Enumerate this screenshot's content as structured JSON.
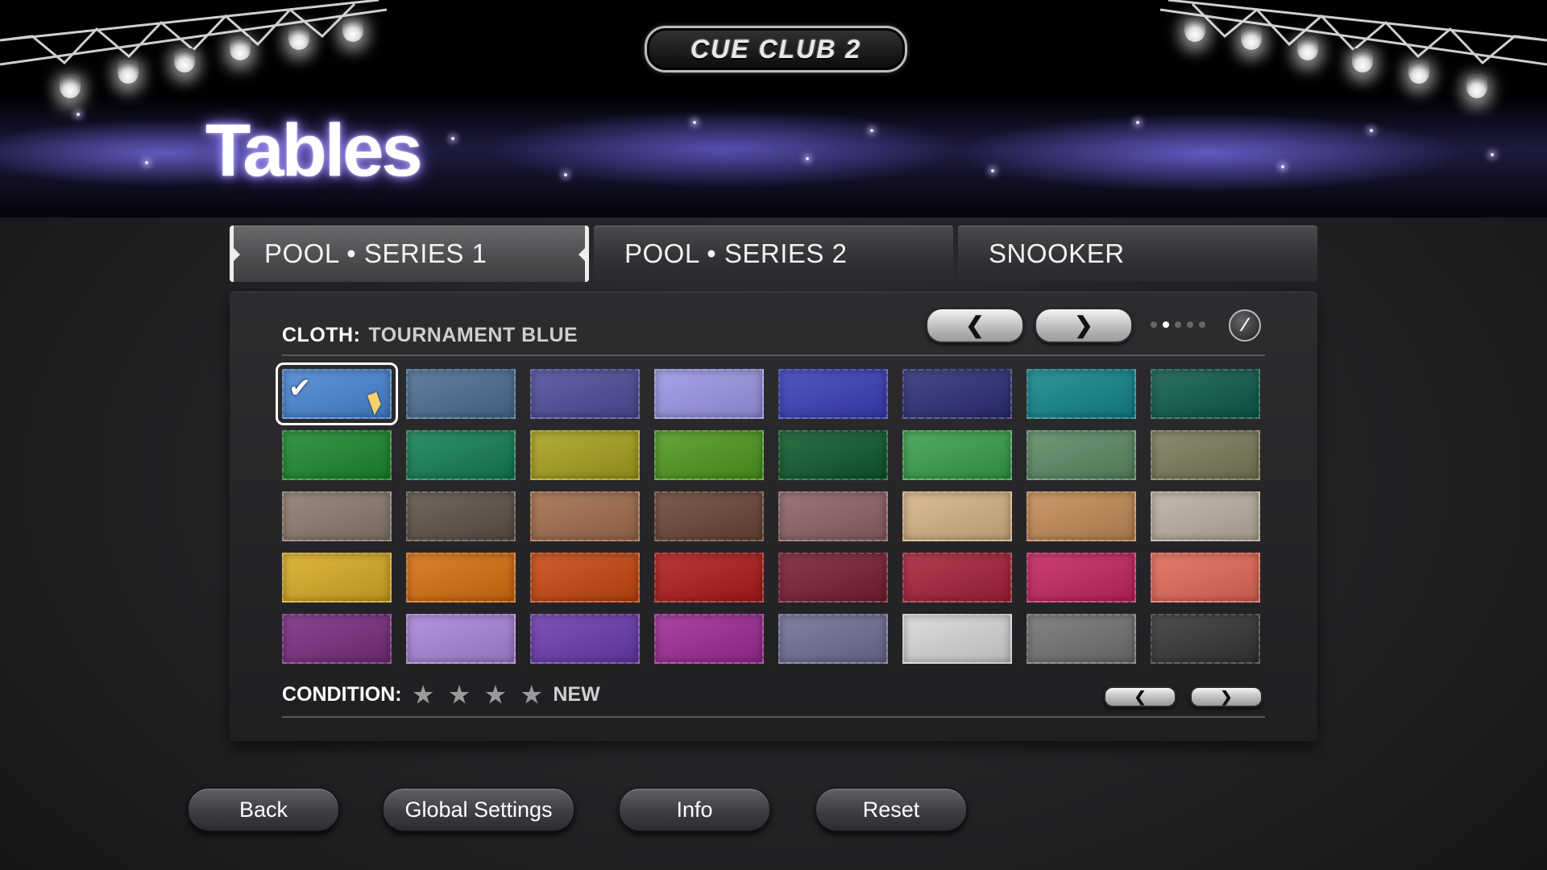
{
  "logo_text": "CUE CLUB 2",
  "page_title": "Tables",
  "tabs": [
    {
      "label": "POOL  •  SERIES 1",
      "active": true
    },
    {
      "label": "POOL  •  SERIES 2",
      "active": false
    },
    {
      "label": "SNOOKER",
      "active": false
    }
  ],
  "cloth": {
    "label": "CLOTH:",
    "value": "TOURNAMENT BLUE",
    "prev_icon": "chevron-left-icon",
    "next_icon": "chevron-right-icon",
    "page_indicator": {
      "total": 5,
      "current": 2
    },
    "swatches": [
      "#4a86d4",
      "#4c6e93",
      "#4e4d9a",
      "#9c97e6",
      "#3b3fb8",
      "#2e2f78",
      "#13868c",
      "#0f5d4d",
      "#1c8a2e",
      "#148055",
      "#a8a21d",
      "#4f9a1e",
      "#0f5b2c",
      "#38a04a",
      "#5e8a65",
      "#7c7b5c",
      "#8c7b6d",
      "#5f5248",
      "#a26e4c",
      "#6b4638",
      "#8e6366",
      "#d7b485",
      "#c48b57",
      "#bdb0a0",
      "#d8ac25",
      "#d8700f",
      "#c84810",
      "#b01c1c",
      "#7a2034",
      "#a8223a",
      "#c42660",
      "#e46a58",
      "#7a2d80",
      "#a986db",
      "#6b3cae",
      "#9e2b96",
      "#6f7096",
      "#d8d8d8",
      "#737373",
      "#363636"
    ],
    "selected_index": 0
  },
  "condition": {
    "label": "CONDITION:",
    "stars": "★ ★ ★ ★",
    "value": "NEW"
  },
  "bottom_buttons": [
    "Back",
    "Global Settings",
    "Info",
    "Reset"
  ]
}
